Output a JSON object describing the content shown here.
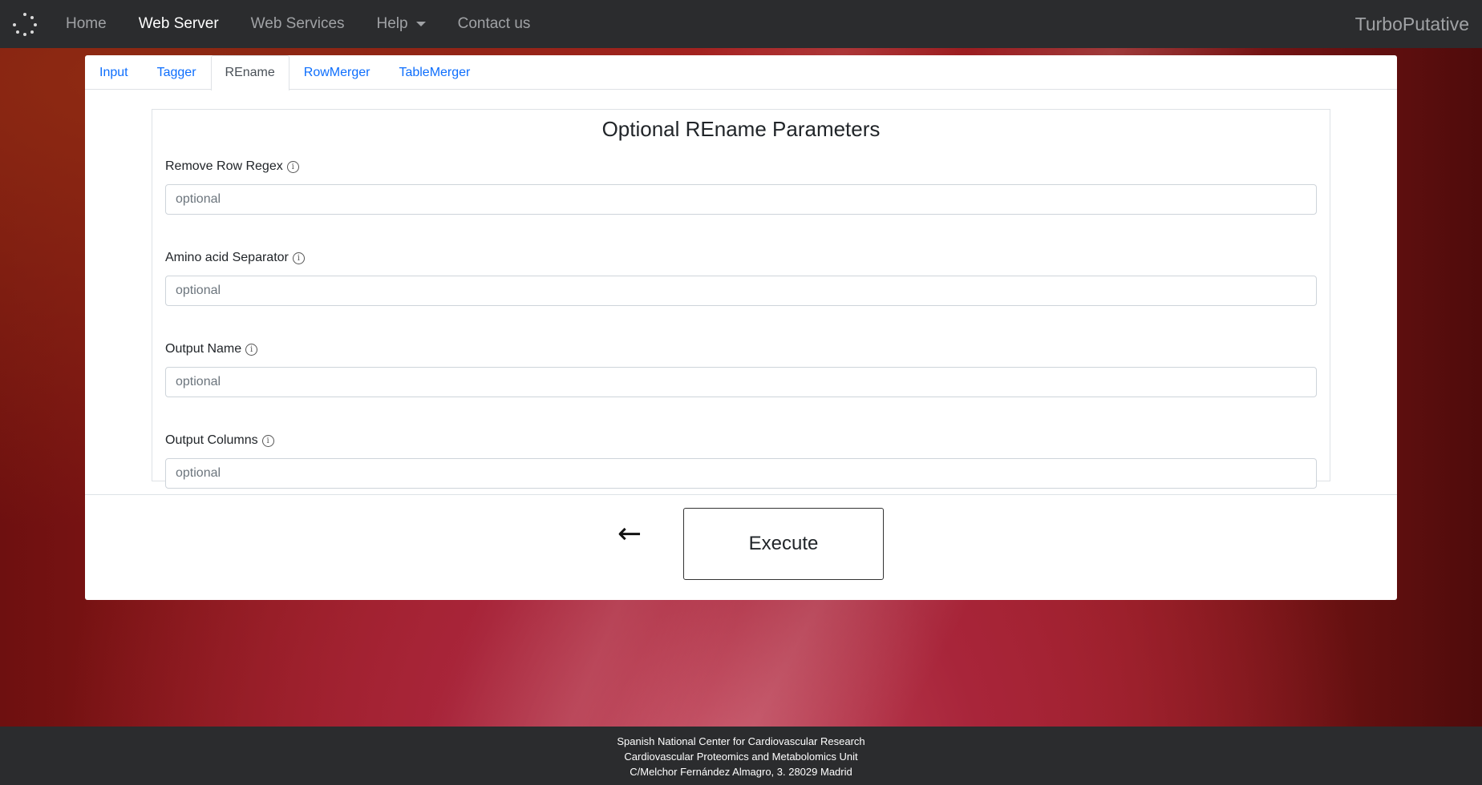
{
  "navbar": {
    "items": [
      {
        "label": "Home"
      },
      {
        "label": "Web Server"
      },
      {
        "label": "Web Services"
      },
      {
        "label": "Help"
      },
      {
        "label": "Contact us"
      }
    ],
    "active_item": "Web Server",
    "brand": "TurboPutative",
    "logo_icon": "spinner-dots-icon"
  },
  "tabs": {
    "items": [
      {
        "label": "Input"
      },
      {
        "label": "Tagger"
      },
      {
        "label": "REname"
      },
      {
        "label": "RowMerger"
      },
      {
        "label": "TableMerger"
      }
    ],
    "active": "REname"
  },
  "params": {
    "title": "Optional REname Parameters",
    "fields": [
      {
        "label": "Remove Row Regex",
        "placeholder": "optional",
        "value": ""
      },
      {
        "label": "Amino acid Separator",
        "placeholder": "optional",
        "value": ""
      },
      {
        "label": "Output Name",
        "placeholder": "optional",
        "value": ""
      },
      {
        "label": "Output Columns",
        "placeholder": "optional",
        "value": ""
      }
    ],
    "info_icon": "info-circle-icon"
  },
  "actions": {
    "back_arrow": "←",
    "execute_label": "Execute"
  },
  "footer": {
    "line1": "Spanish National Center for Cardiovascular Research",
    "line2": "Cardiovascular Proteomics and Metabolomics Unit",
    "line3": "C/Melchor Fernández Almagro, 3. 28029 Madrid"
  },
  "colors": {
    "navbar_bg": "#2b2c2e",
    "link_blue": "#0d6efd",
    "background_red": "#a8253a"
  }
}
